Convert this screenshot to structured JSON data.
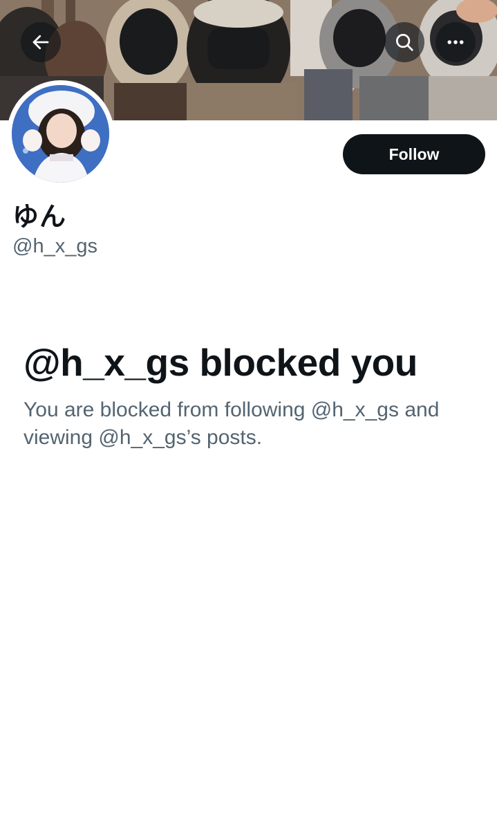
{
  "header": {
    "back_icon": "back-arrow-icon",
    "search_icon": "search-icon",
    "more_icon": "more-horizontal-icon"
  },
  "profile": {
    "display_name": "ゆん",
    "handle": "@h_x_gs",
    "follow_label": "Follow"
  },
  "blocked": {
    "title": "@h_x_gs blocked you",
    "description": "You are blocked from following @h_x_gs and viewing @h_x_gs’s posts."
  },
  "colors": {
    "text_primary": "#0f1419",
    "text_secondary": "#536471",
    "button_bg": "#0f1419",
    "button_text": "#ffffff",
    "background": "#ffffff"
  }
}
